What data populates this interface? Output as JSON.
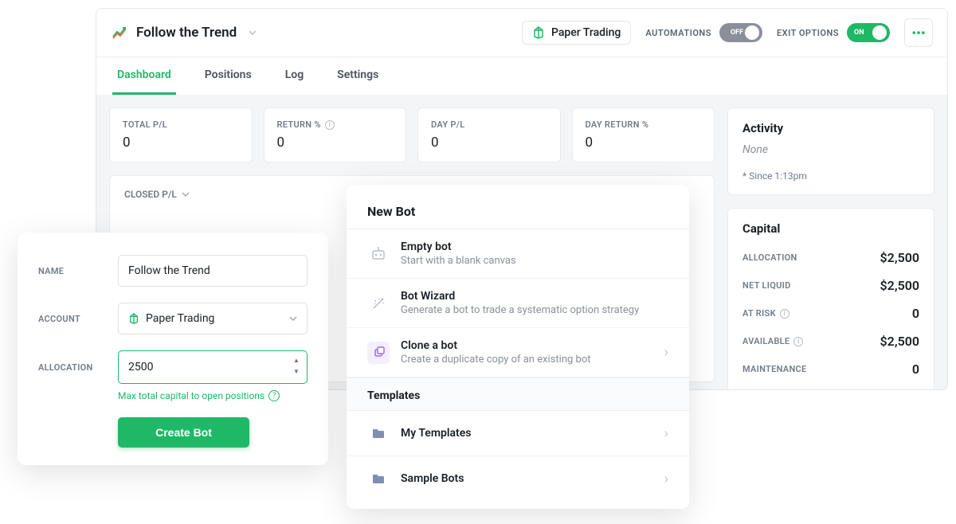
{
  "header": {
    "title": "Follow the Trend",
    "paper_badge": "Paper Trading",
    "automations_label": "AUTOMATIONS",
    "automations_state": "OFF",
    "exit_options_label": "EXIT OPTIONS",
    "exit_options_state": "ON"
  },
  "tabs": [
    "Dashboard",
    "Positions",
    "Log",
    "Settings"
  ],
  "active_tab": "Dashboard",
  "stats": [
    {
      "label": "TOTAL P/L",
      "value": "0",
      "info": false
    },
    {
      "label": "RETURN %",
      "value": "0",
      "info": true
    },
    {
      "label": "DAY P/L",
      "value": "0",
      "info": false
    },
    {
      "label": "DAY RETURN %",
      "value": "0",
      "info": false
    }
  ],
  "closed_pl_label": "CLOSED P/L",
  "activity": {
    "title": "Activity",
    "none": "None",
    "since": "* Since 1:13pm"
  },
  "capital": {
    "title": "Capital",
    "rows": [
      {
        "label": "ALLOCATION",
        "value": "$2,500",
        "info": false
      },
      {
        "label": "NET LIQUID",
        "value": "$2,500",
        "info": false
      },
      {
        "label": "AT RISK",
        "value": "0",
        "info": true
      },
      {
        "label": "AVAILABLE",
        "value": "$2,500",
        "info": true
      },
      {
        "label": "MAINTENANCE",
        "value": "0",
        "info": false
      }
    ]
  },
  "create_modal": {
    "name_label": "NAME",
    "name_value": "Follow the Trend",
    "account_label": "ACCOUNT",
    "account_value": "Paper Trading",
    "allocation_label": "ALLOCATION",
    "allocation_value": "2500",
    "helper": "Max total capital to open positions",
    "submit": "Create Bot"
  },
  "newbot": {
    "title": "New Bot",
    "options": [
      {
        "title": "Empty bot",
        "desc": "Start with a blank canvas",
        "icon": "robot"
      },
      {
        "title": "Bot Wizard",
        "desc": "Generate a bot to trade a systematic option strategy",
        "icon": "wand"
      },
      {
        "title": "Clone a bot",
        "desc": "Create a duplicate copy of an existing bot",
        "icon": "copy",
        "chevron": true
      }
    ],
    "templates_label": "Templates",
    "templates": [
      {
        "title": "My Templates"
      },
      {
        "title": "Sample Bots"
      }
    ]
  }
}
